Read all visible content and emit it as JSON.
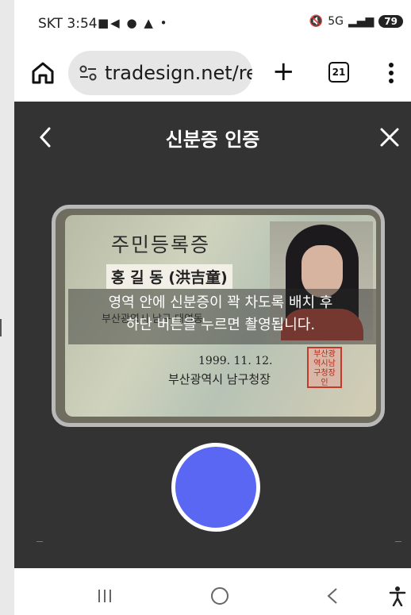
{
  "status": {
    "carrier_time": "SKT 3:54",
    "left_icons": "■◀ ● ▲ •",
    "network": "5G",
    "battery": "79"
  },
  "browser": {
    "url": "tradesign.net/re",
    "tab_count": "21"
  },
  "header": {
    "title": "신분증 인증"
  },
  "id_card": {
    "title": "주민등록증",
    "name": "홍 길 동 (洪吉童)",
    "address": "부산광역시 남구 대연동",
    "issue_date": "1999. 11. 12.",
    "issuer": "부산광역시 남구청장",
    "seal_text": "부산광역시남구청장인"
  },
  "guide": {
    "line1": "영역 안에 신분증이 꽉 차도록 배치 후",
    "line2": "하단 버튼을 누르면 촬영됩니다."
  },
  "colors": {
    "shutter": "#5a67f2",
    "background": "#333333"
  }
}
